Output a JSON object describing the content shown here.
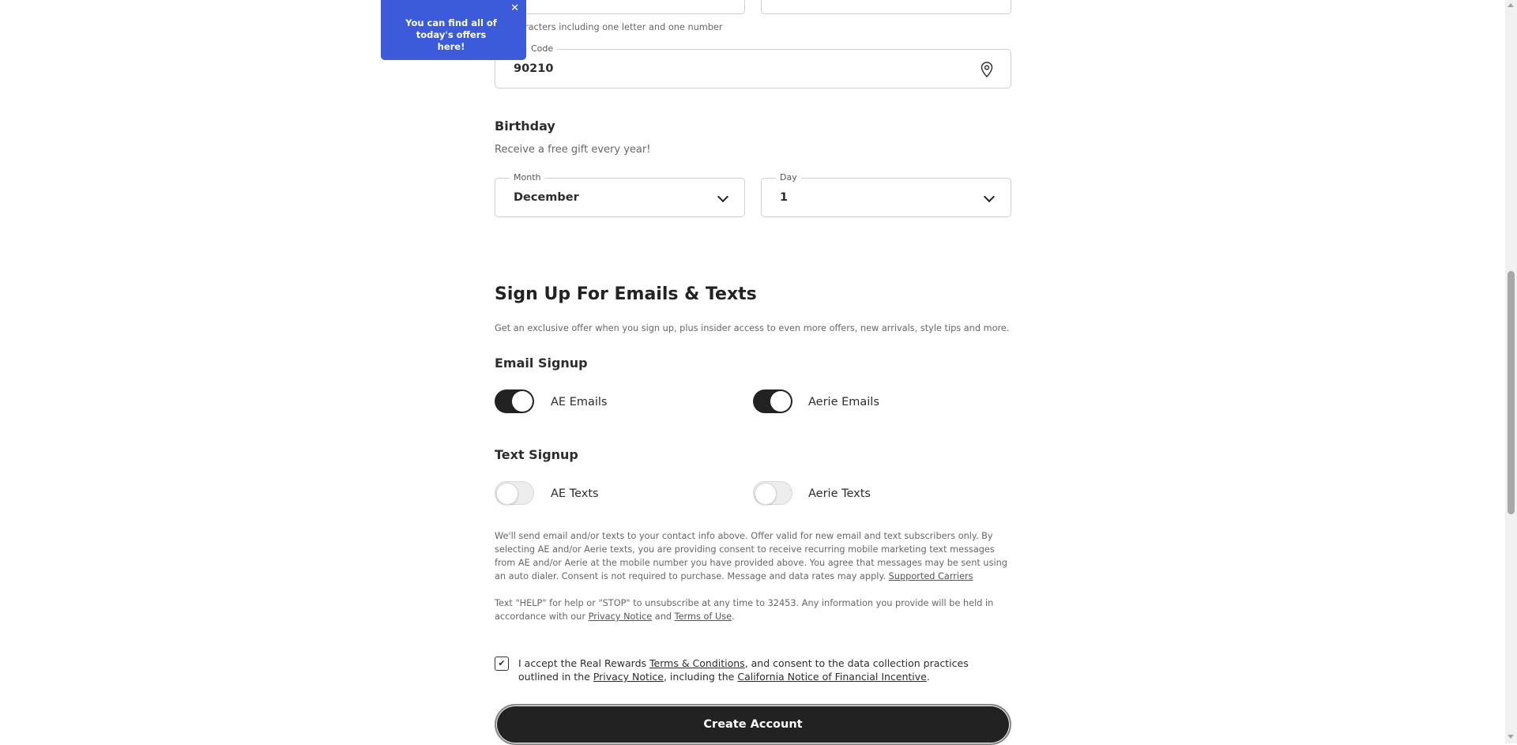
{
  "password_hint": "aracters including one letter and one number",
  "zip": {
    "label": "Code",
    "value": "90210",
    "icon": "location-pin-icon"
  },
  "birthday": {
    "title": "Birthday",
    "subtitle": "Receive a free gift every year!",
    "month": {
      "label": "Month",
      "value": "December"
    },
    "day": {
      "label": "Day",
      "value": "1"
    }
  },
  "signup": {
    "title": "Sign Up For Emails & Texts",
    "description": "Get an exclusive offer when you sign up, plus insider access to even more offers, new arrivals, style tips and more.",
    "email_title": "Email Signup",
    "ae_emails": "AE Emails",
    "aerie_emails": "Aerie Emails",
    "text_title": "Text Signup",
    "ae_texts": "AE Texts",
    "aerie_texts": "Aerie Texts"
  },
  "legal": {
    "p1": "We'll send email and/or texts to your contact info above. Offer valid for new email and text subscribers only. By selecting AE and/or Aerie texts, you are providing consent to receive recurring mobile marketing text messages from AE and/or Aerie at the mobile number you have provided above. You agree that messages may be sent using an auto dialer. Consent is not required to purchase. Message and data rates may apply.",
    "supported_carriers": "Supported Carriers",
    "p2_start": "Text \"HELP\" for help or \"STOP\" to unsubscribe at any time to 32453. Any information you provide will be held in accordance with our",
    "privacy_notice": "Privacy Notice",
    "and": "and",
    "terms_of_use": "Terms of Use",
    "period": "."
  },
  "consent": {
    "prefix": "I accept the Real Rewards",
    "terms": "Terms & Conditions",
    "middle": ", and consent to the data collection practices outlined in the",
    "privacy": "Privacy Notice",
    "including": ", including the",
    "california": "California Notice of Financial Incentive",
    "end": "."
  },
  "create_button": "Create Account",
  "tooltip": {
    "text": "You can find all of today's offers here!",
    "close": "✕"
  },
  "colors": {
    "tooltip_bg": "#3b5bdb",
    "toggle_on": "#222222",
    "button_bg": "#222222"
  }
}
